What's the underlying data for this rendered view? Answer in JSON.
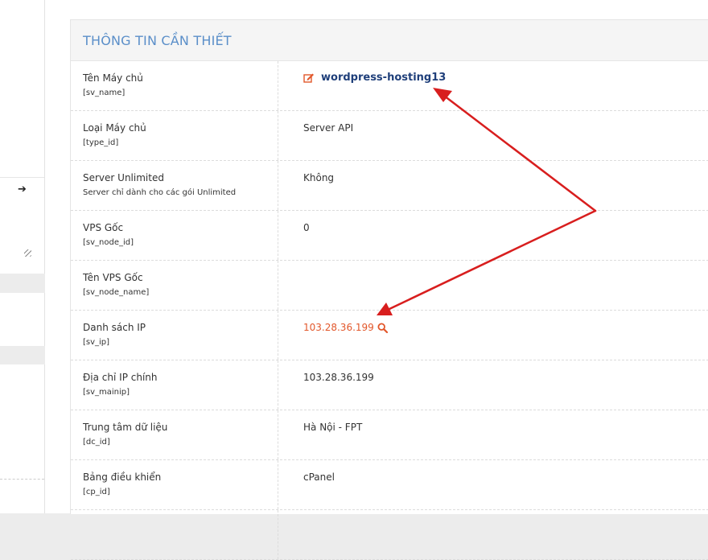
{
  "panel": {
    "title": "THÔNG TIN CẦN THIẾT"
  },
  "rows": [
    {
      "label": "Tên Máy chủ",
      "key": "[sv_name]",
      "value": "wordpress-hosting13"
    },
    {
      "label": "Loại Máy chủ",
      "key": "[type_id]",
      "value": "Server API"
    },
    {
      "label": "Server Unlimited",
      "key": "Server chỉ dành cho các gói Unlimited",
      "value": "Không"
    },
    {
      "label": "VPS Gốc",
      "key": "[sv_node_id]",
      "value": "0"
    },
    {
      "label": "Tên VPS Gốc",
      "key": "[sv_node_name]",
      "value": ""
    },
    {
      "label": "Danh sách IP",
      "key": "[sv_ip]",
      "value": "103.28.36.199"
    },
    {
      "label": "Địa chỉ IP chính",
      "key": "[sv_mainip]",
      "value": "103.28.36.199"
    },
    {
      "label": "Trung tâm dữ liệu",
      "key": "[dc_id]",
      "value": "Hà Nội - FPT"
    },
    {
      "label": "Bảng điều khiển",
      "key": "[cp_id]",
      "value": "cPanel"
    },
    {
      "label": "",
      "key": "",
      "value": ""
    }
  ],
  "icons": {
    "edit": "edit-icon",
    "search": "search-icon",
    "arrow": "arrow-right-icon",
    "resize": "resize-handle-icon"
  },
  "colors": {
    "title": "#5b8fc9",
    "link": "#1f3f7a",
    "ip_link": "#e2572b",
    "annotation_arrow": "#d81e1e"
  }
}
